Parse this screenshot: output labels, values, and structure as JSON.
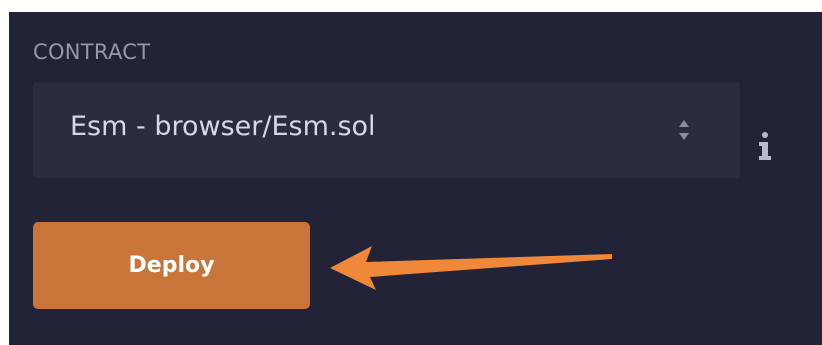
{
  "contract_section": {
    "label": "CONTRACT",
    "selected_contract": "Esm - browser/Esm.sol",
    "select_arrows_icon": "up-down-caret-icon",
    "info_icon": "info-icon"
  },
  "deploy": {
    "label": "Deploy"
  },
  "annotation": {
    "icon": "arrow-left-icon",
    "color": "#f0883a"
  },
  "colors": {
    "panel_background": "#222336",
    "select_background": "#2a2c3f",
    "label_text": "#9597ab",
    "select_text": "#d7d8e5",
    "deploy_button": "#c97539",
    "deploy_text": "#ffffff"
  }
}
